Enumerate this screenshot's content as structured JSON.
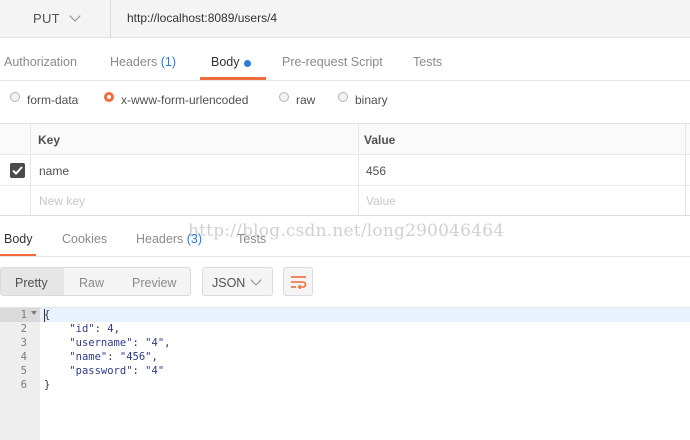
{
  "request": {
    "method": "PUT",
    "url": "http://localhost:8089/users/4"
  },
  "request_tabs": [
    {
      "label": "Authorization"
    },
    {
      "label": "Headers",
      "count": "(1)"
    },
    {
      "label": "Body"
    },
    {
      "label": "Pre-request Script"
    },
    {
      "label": "Tests"
    }
  ],
  "body_types": [
    {
      "label": "form-data",
      "selected": false
    },
    {
      "label": "x-www-form-urlencoded",
      "selected": true
    },
    {
      "label": "raw",
      "selected": false
    },
    {
      "label": "binary",
      "selected": false
    }
  ],
  "params_table": {
    "headers": [
      "Key",
      "Value"
    ],
    "rows": [
      {
        "key": "name",
        "value": "456",
        "enabled": true
      }
    ],
    "placeholders": {
      "key": "New key",
      "value": "Value"
    }
  },
  "response_tabs": [
    {
      "label": "Body"
    },
    {
      "label": "Cookies"
    },
    {
      "label": "Headers",
      "count": "(3)"
    },
    {
      "label": "Tests"
    }
  ],
  "view_modes": [
    "Pretty",
    "Raw",
    "Preview"
  ],
  "format": "JSON",
  "response_body": {
    "line_numbers": [
      "1",
      "2",
      "3",
      "4",
      "5",
      "6"
    ],
    "open": "{",
    "fields": [
      {
        "key": "\"id\"",
        "value": "4",
        "sep": ","
      },
      {
        "key": "\"username\"",
        "value": "\"4\"",
        "sep": ","
      },
      {
        "key": "\"name\"",
        "value": "\"456\"",
        "sep": ","
      },
      {
        "key": "\"password\"",
        "value": "\"4\"",
        "sep": ""
      }
    ],
    "close": "}"
  },
  "watermark": "http://blog.csdn.net/long290046464",
  "colors": {
    "accent": "#f26b3a",
    "link": "#2a7dd6"
  }
}
